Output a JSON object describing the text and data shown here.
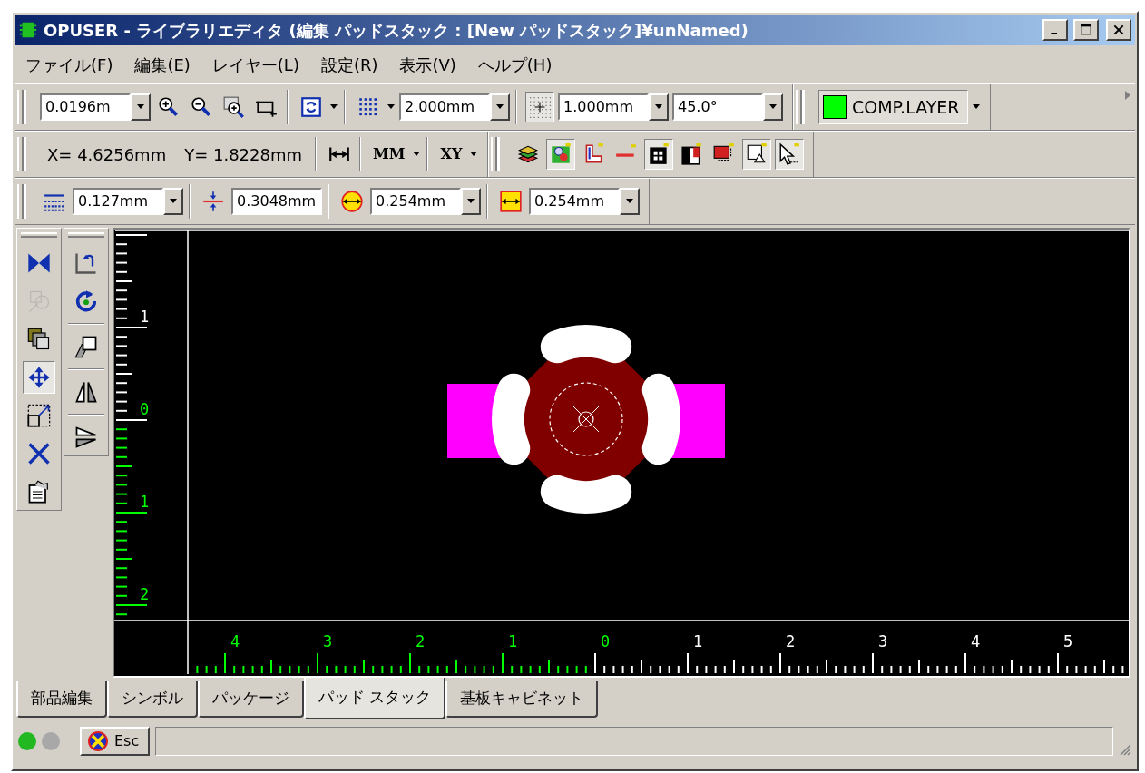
{
  "window": {
    "title": "OPUSER - ライブラリエディタ (編集 パッドスタック : [New パッドスタック]¥unNamed)"
  },
  "menu": [
    {
      "label": "ファイル(F)"
    },
    {
      "label": "編集(E)"
    },
    {
      "label": "レイヤー(L)"
    },
    {
      "label": "設定(R)"
    },
    {
      "label": "表示(V)"
    },
    {
      "label": "ヘルプ(H)"
    }
  ],
  "toolbar_rows": [
    [
      [
        [
          {
            "kind": "combo",
            "value": "0.0196m"
          },
          {
            "kind": "icon",
            "pressed": false
          },
          {
            "kind": "icon",
            "pressed": false
          },
          {
            "kind": "icon",
            "pressed": false
          },
          {
            "kind": "icon",
            "pressed": false
          }
        ],
        [
          {
            "kind": "icon",
            "pressed": false
          }
        ],
        [
          {
            "kind": "icon",
            "pressed": false
          },
          {
            "kind": "combo",
            "value": "2.000mm"
          }
        ],
        [
          {
            "kind": "icon",
            "pressed": true
          },
          {
            "kind": "combo",
            "value": "1.000mm"
          },
          {
            "kind": "combo",
            "value": "45.0°"
          }
        ]
      ],
      [
        [
          {
            "kind": "layer",
            "value": "COMP.LAYER",
            "color": "#00ff00"
          }
        ]
      ]
    ],
    [
      [
        [
          {
            "kind": "text",
            "value": "X= 4.6256mm"
          },
          {
            "kind": "text",
            "value": "Y= 1.8228mm"
          }
        ],
        [
          {
            "kind": "icon",
            "pressed": false
          }
        ],
        [
          {
            "kind": "menu_button",
            "value": "MM"
          }
        ],
        [
          {
            "kind": "menu_button",
            "value": "XY"
          }
        ]
      ],
      [
        [
          {
            "kind": "icon",
            "pressed": false
          },
          {
            "kind": "icon",
            "pressed": true
          },
          {
            "kind": "icon",
            "pressed": false
          },
          {
            "kind": "icon",
            "pressed": false
          },
          {
            "kind": "icon",
            "pressed": true
          },
          {
            "kind": "icon",
            "pressed": false
          },
          {
            "kind": "icon",
            "pressed": false
          },
          {
            "kind": "icon",
            "pressed": true
          },
          {
            "kind": "icon",
            "pressed": true
          }
        ]
      ]
    ],
    [
      [
        [
          {
            "kind": "icon",
            "pressed": false
          },
          {
            "kind": "combo",
            "value": "0.127mm"
          }
        ],
        [
          {
            "kind": "icon",
            "pressed": false
          },
          {
            "kind": "field",
            "value": "0.3048mm"
          }
        ],
        [
          {
            "kind": "icon",
            "pressed": false
          },
          {
            "kind": "combo",
            "value": "0.254mm"
          }
        ],
        [
          {
            "kind": "icon",
            "pressed": false
          },
          {
            "kind": "combo",
            "value": "0.254mm"
          }
        ]
      ]
    ]
  ],
  "side_toolbars": [
    [
      {
        "pressed": false,
        "disabled": false
      },
      {
        "pressed": false,
        "disabled": true
      },
      {
        "pressed": false,
        "disabled": false
      },
      {
        "pressed": true,
        "disabled": false
      },
      {
        "pressed": false,
        "disabled": false
      },
      {
        "pressed": false,
        "disabled": false
      },
      {
        "pressed": false,
        "disabled": false
      }
    ],
    [
      {
        "pressed": false,
        "disabled": false
      },
      {
        "pressed": false,
        "disabled": false
      },
      {
        "pressed": false,
        "disabled": false
      },
      {
        "pressed": false,
        "disabled": false
      },
      {
        "pressed": false,
        "disabled": false
      }
    ]
  ],
  "vertical_ruler": [
    {
      "text": "1",
      "color": "#ffffff"
    },
    {
      "text": "0",
      "color": "#00ff00"
    },
    {
      "text": "1",
      "color": "#00ff00"
    },
    {
      "text": "2",
      "color": "#00ff00"
    }
  ],
  "horizontal_ruler": [
    {
      "text": "4",
      "color": "#00ff00"
    },
    {
      "text": "3",
      "color": "#00ff00"
    },
    {
      "text": "2",
      "color": "#00ff00"
    },
    {
      "text": "1",
      "color": "#00ff00"
    },
    {
      "text": "0",
      "color": "#00ff00"
    },
    {
      "text": "1",
      "color": "#ffffff"
    },
    {
      "text": "2",
      "color": "#ffffff"
    },
    {
      "text": "3",
      "color": "#ffffff"
    },
    {
      "text": "4",
      "color": "#ffffff"
    },
    {
      "text": "5",
      "color": "#ffffff"
    }
  ],
  "tabs": [
    {
      "label": "部品編集",
      "selected": false
    },
    {
      "label": "シンボル",
      "selected": false
    },
    {
      "label": "パッケージ",
      "selected": false
    },
    {
      "label": "パッド スタック",
      "selected": true
    },
    {
      "label": "基板キャビネット",
      "selected": false
    }
  ],
  "status_bar": {
    "leds": [
      {
        "color": "#22b822"
      },
      {
        "color": "#a8a8a8"
      }
    ],
    "esc_button": "Esc"
  }
}
